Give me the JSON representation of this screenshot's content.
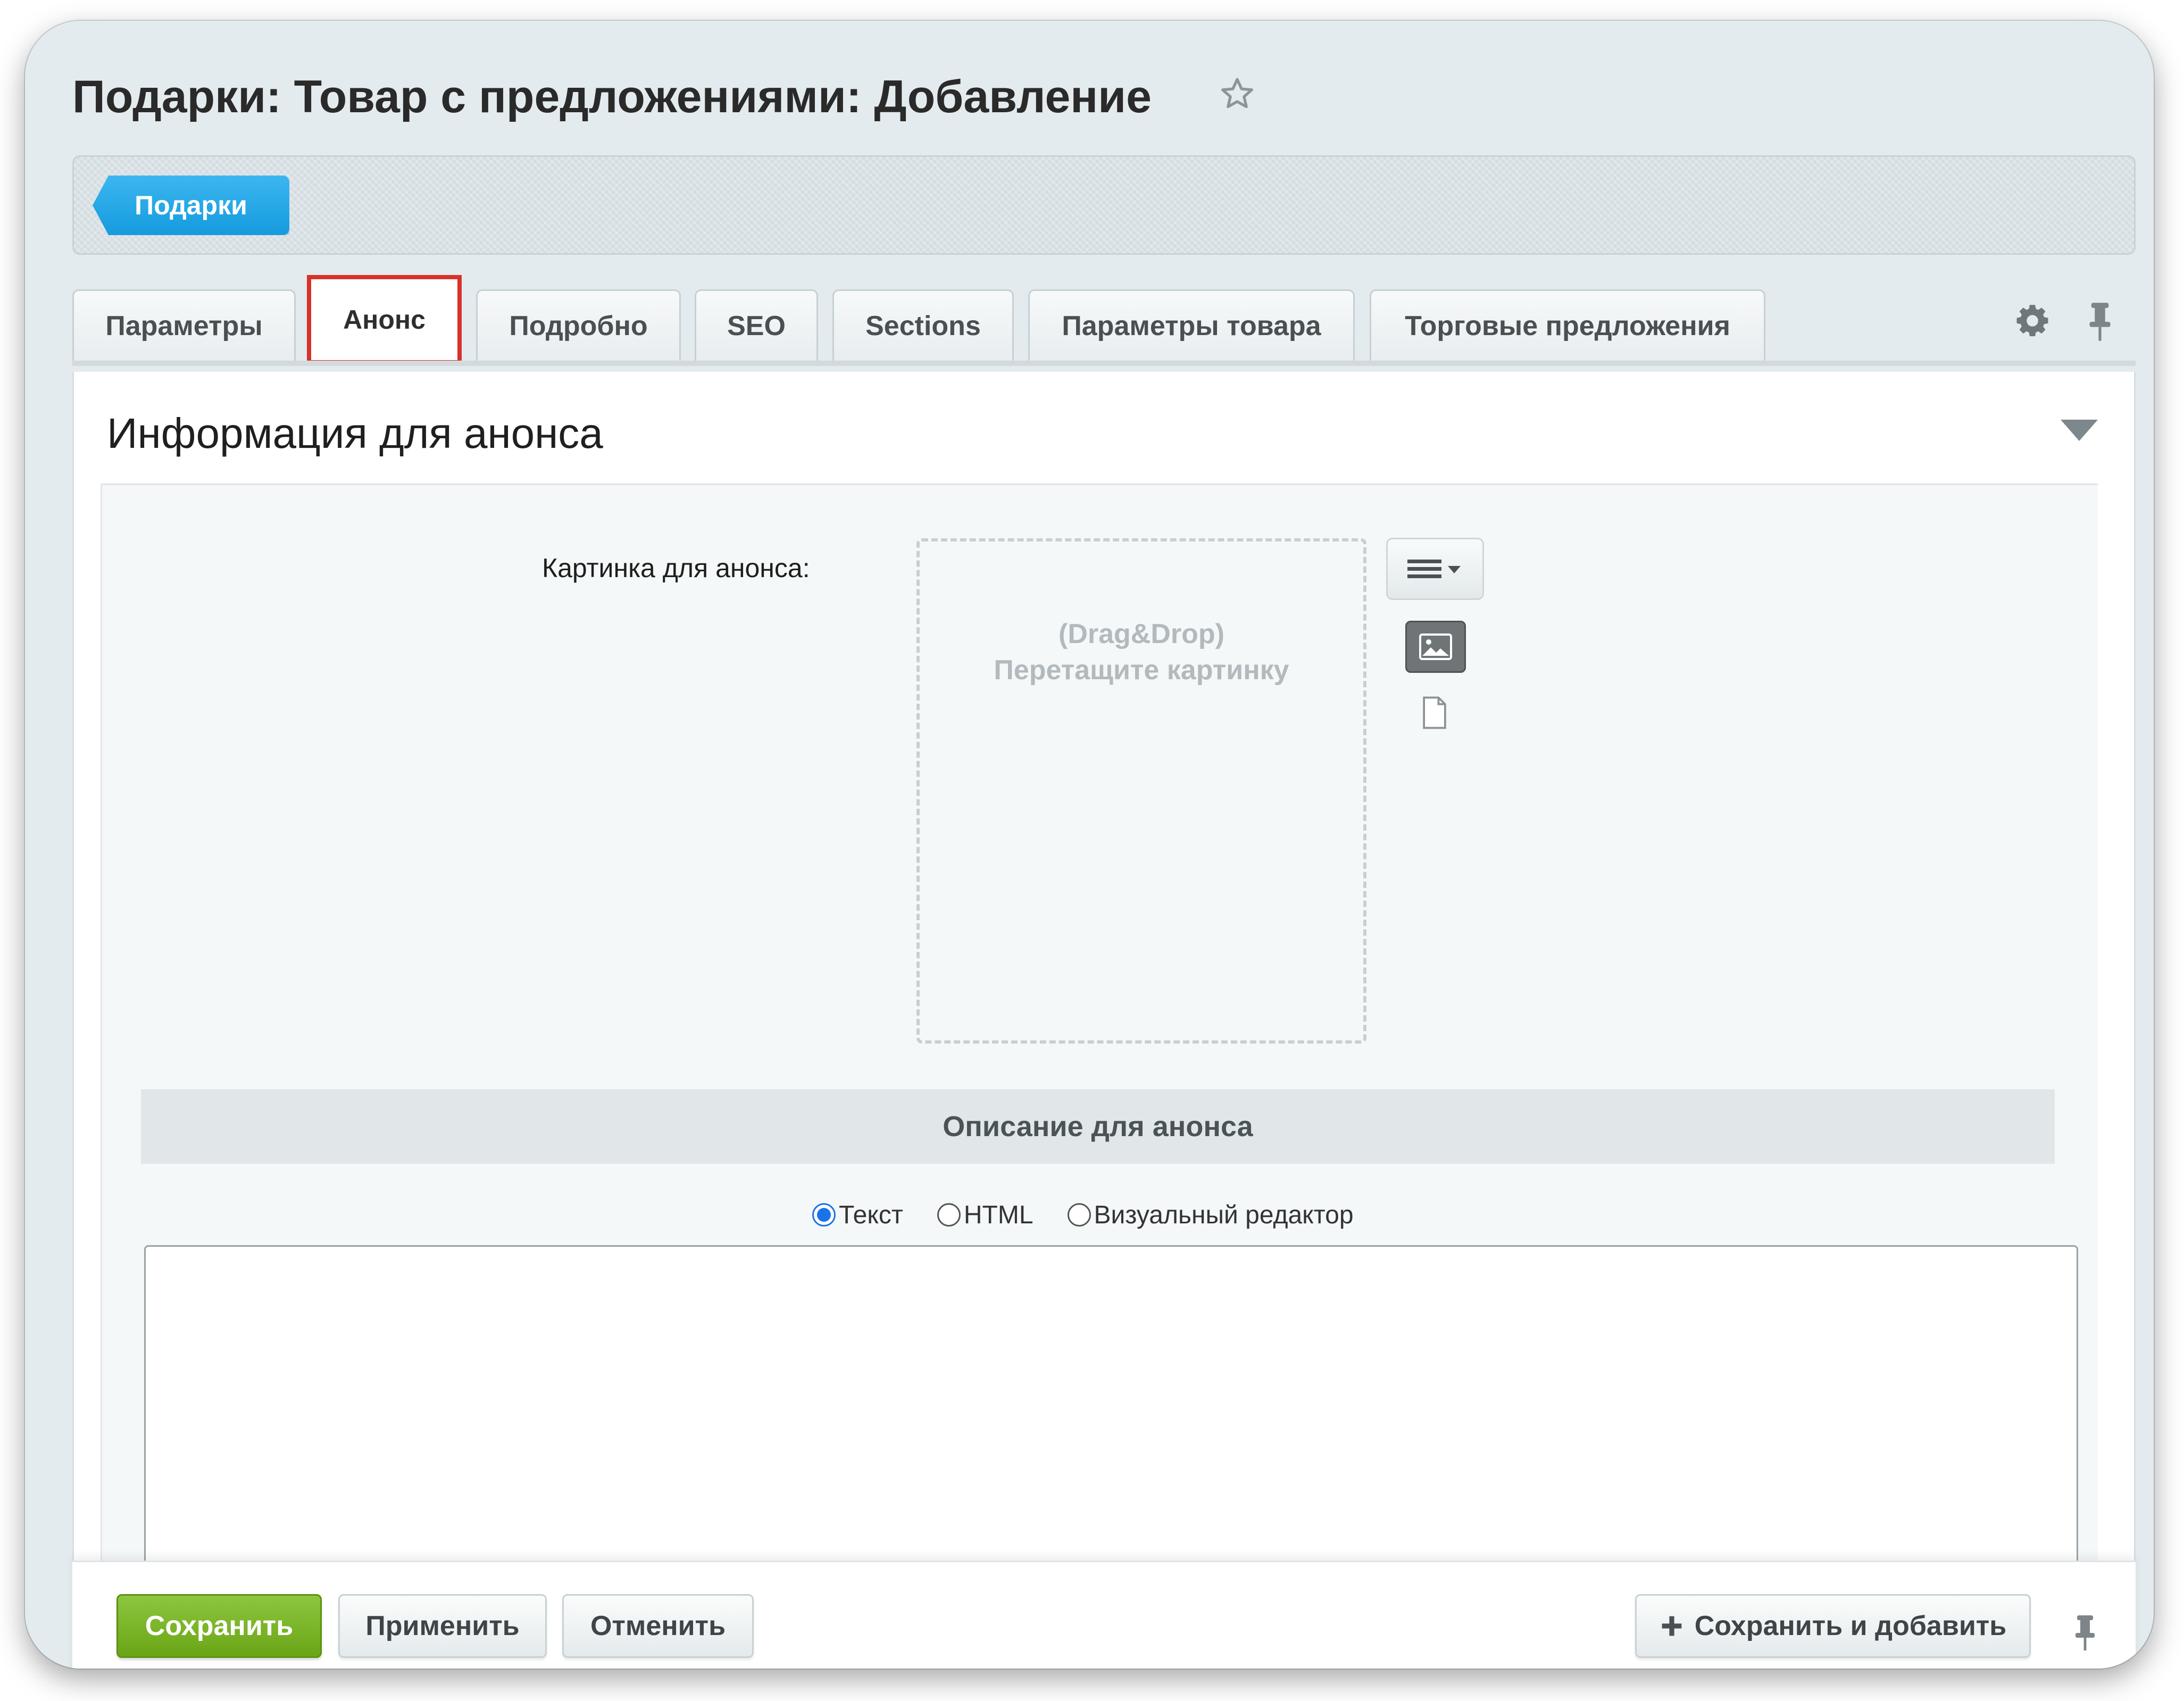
{
  "page": {
    "title": "Подарки: Товар с предложениями: Добавление"
  },
  "breadcrumb": {
    "label": "Подарки"
  },
  "tabs": [
    {
      "label": "Параметры"
    },
    {
      "label": "Анонс",
      "active": true
    },
    {
      "label": "Подробно"
    },
    {
      "label": "SEO"
    },
    {
      "label": "Sections"
    },
    {
      "label": "Параметры товара"
    },
    {
      "label": "Торговые предложения"
    }
  ],
  "section": {
    "title": "Информация для анонса",
    "picture_label": "Картинка для анонса:",
    "drop_hint_line1": "(Drag&Drop)",
    "drop_hint_line2": "Перетащите картинку",
    "description_header": "Описание для анонса",
    "editor_modes": [
      {
        "label": "Текст",
        "checked": true
      },
      {
        "label": "HTML",
        "checked": false
      },
      {
        "label": "Визуальный редактор",
        "checked": false
      }
    ],
    "description_value": ""
  },
  "actions": {
    "save": "Сохранить",
    "apply": "Применить",
    "cancel": "Отменить",
    "save_add": "Сохранить и добавить"
  },
  "icons": {
    "favorite": "star-icon",
    "settings": "gear-icon",
    "pin": "pin-icon",
    "collapse": "triangle-down-icon",
    "menu": "hamburger-icon",
    "image": "image-icon",
    "file": "file-icon",
    "plus": "plus-icon"
  },
  "colors": {
    "breadcrumb_blue": "#1fa6e6",
    "save_green": "#7bb52a",
    "active_tab_outline": "#d83228"
  }
}
